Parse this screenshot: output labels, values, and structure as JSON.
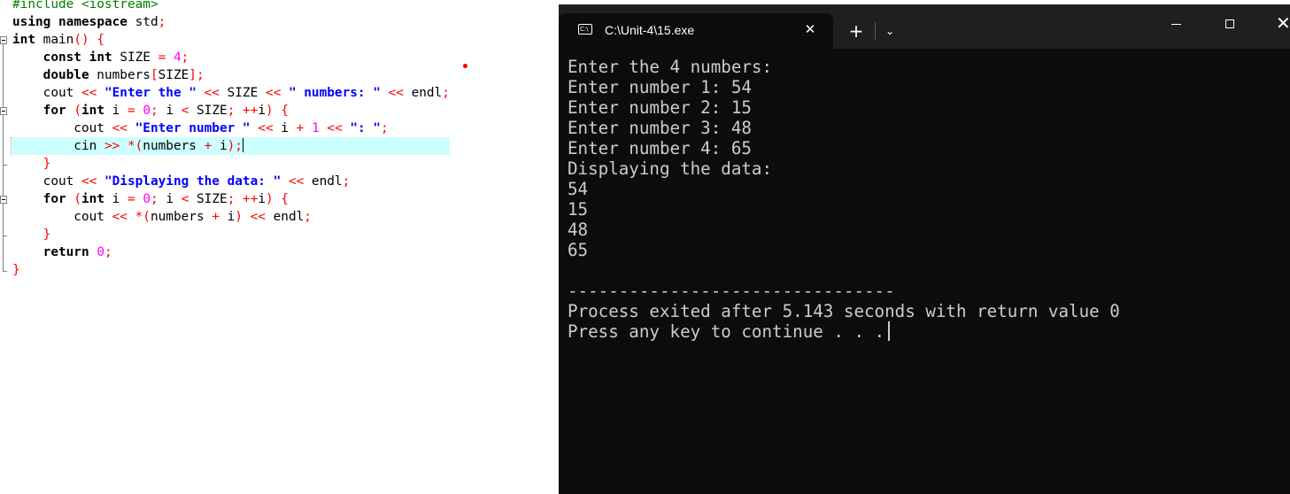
{
  "editor": {
    "lines": [
      {
        "tokens": [
          {
            "c": "pre",
            "t": "#include <iostream>"
          }
        ]
      },
      {
        "tokens": [
          {
            "c": "kw",
            "t": "using"
          },
          {
            "c": "plain",
            "t": " "
          },
          {
            "c": "kw",
            "t": "namespace"
          },
          {
            "c": "plain",
            "t": " std"
          },
          {
            "c": "op",
            "t": ";"
          }
        ]
      },
      {
        "tokens": [
          {
            "c": "kw",
            "t": "int"
          },
          {
            "c": "plain",
            "t": " main"
          },
          {
            "c": "op",
            "t": "()"
          },
          {
            "c": "plain",
            "t": " "
          },
          {
            "c": "op",
            "t": "{"
          }
        ]
      },
      {
        "tokens": [
          {
            "c": "plain",
            "t": "    "
          },
          {
            "c": "kw",
            "t": "const"
          },
          {
            "c": "plain",
            "t": " "
          },
          {
            "c": "kw",
            "t": "int"
          },
          {
            "c": "plain",
            "t": " SIZE "
          },
          {
            "c": "op",
            "t": "="
          },
          {
            "c": "plain",
            "t": " "
          },
          {
            "c": "num",
            "t": "4"
          },
          {
            "c": "op",
            "t": ";"
          }
        ]
      },
      {
        "tokens": [
          {
            "c": "plain",
            "t": "    "
          },
          {
            "c": "kw",
            "t": "double"
          },
          {
            "c": "plain",
            "t": " numbers"
          },
          {
            "c": "op",
            "t": "["
          },
          {
            "c": "plain",
            "t": "SIZE"
          },
          {
            "c": "op",
            "t": "];"
          }
        ]
      },
      {
        "tokens": [
          {
            "c": "plain",
            "t": "    cout "
          },
          {
            "c": "op",
            "t": "<<"
          },
          {
            "c": "plain",
            "t": " "
          },
          {
            "c": "str",
            "t": "\"Enter the \""
          },
          {
            "c": "plain",
            "t": " "
          },
          {
            "c": "op",
            "t": "<<"
          },
          {
            "c": "plain",
            "t": " SIZE "
          },
          {
            "c": "op",
            "t": "<<"
          },
          {
            "c": "plain",
            "t": " "
          },
          {
            "c": "str",
            "t": "\" numbers: \""
          },
          {
            "c": "plain",
            "t": " "
          },
          {
            "c": "op",
            "t": "<<"
          },
          {
            "c": "plain",
            "t": " endl"
          },
          {
            "c": "op",
            "t": ";"
          }
        ]
      },
      {
        "tokens": [
          {
            "c": "plain",
            "t": "    "
          },
          {
            "c": "kw",
            "t": "for"
          },
          {
            "c": "plain",
            "t": " "
          },
          {
            "c": "op",
            "t": "("
          },
          {
            "c": "kw",
            "t": "int"
          },
          {
            "c": "plain",
            "t": " i "
          },
          {
            "c": "op",
            "t": "="
          },
          {
            "c": "plain",
            "t": " "
          },
          {
            "c": "num",
            "t": "0"
          },
          {
            "c": "op",
            "t": ";"
          },
          {
            "c": "plain",
            "t": " i "
          },
          {
            "c": "op",
            "t": "<"
          },
          {
            "c": "plain",
            "t": " SIZE"
          },
          {
            "c": "op",
            "t": ";"
          },
          {
            "c": "plain",
            "t": " "
          },
          {
            "c": "op",
            "t": "++"
          },
          {
            "c": "plain",
            "t": "i"
          },
          {
            "c": "op",
            "t": ")"
          },
          {
            "c": "plain",
            "t": " "
          },
          {
            "c": "op",
            "t": "{"
          }
        ]
      },
      {
        "tokens": [
          {
            "c": "plain",
            "t": "        cout "
          },
          {
            "c": "op",
            "t": "<<"
          },
          {
            "c": "plain",
            "t": " "
          },
          {
            "c": "str",
            "t": "\"Enter number \""
          },
          {
            "c": "plain",
            "t": " "
          },
          {
            "c": "op",
            "t": "<<"
          },
          {
            "c": "plain",
            "t": " i "
          },
          {
            "c": "op",
            "t": "+"
          },
          {
            "c": "plain",
            "t": " "
          },
          {
            "c": "num",
            "t": "1"
          },
          {
            "c": "plain",
            "t": " "
          },
          {
            "c": "op",
            "t": "<<"
          },
          {
            "c": "plain",
            "t": " "
          },
          {
            "c": "str",
            "t": "\": \""
          },
          {
            "c": "op",
            "t": ";"
          }
        ]
      },
      {
        "active": true,
        "tokens": [
          {
            "c": "plain",
            "t": "        cin "
          },
          {
            "c": "op",
            "t": ">>"
          },
          {
            "c": "plain",
            "t": " "
          },
          {
            "c": "op",
            "t": "*("
          },
          {
            "c": "plain",
            "t": "numbers "
          },
          {
            "c": "op",
            "t": "+"
          },
          {
            "c": "plain",
            "t": " i"
          },
          {
            "c": "op",
            "t": ");"
          }
        ]
      },
      {
        "tokens": [
          {
            "c": "plain",
            "t": "    "
          },
          {
            "c": "op",
            "t": "}"
          }
        ]
      },
      {
        "tokens": [
          {
            "c": "plain",
            "t": "    cout "
          },
          {
            "c": "op",
            "t": "<<"
          },
          {
            "c": "plain",
            "t": " "
          },
          {
            "c": "str",
            "t": "\"Displaying the data: \""
          },
          {
            "c": "plain",
            "t": " "
          },
          {
            "c": "op",
            "t": "<<"
          },
          {
            "c": "plain",
            "t": " endl"
          },
          {
            "c": "op",
            "t": ";"
          }
        ]
      },
      {
        "tokens": [
          {
            "c": "plain",
            "t": "    "
          },
          {
            "c": "kw",
            "t": "for"
          },
          {
            "c": "plain",
            "t": " "
          },
          {
            "c": "op",
            "t": "("
          },
          {
            "c": "kw",
            "t": "int"
          },
          {
            "c": "plain",
            "t": " i "
          },
          {
            "c": "op",
            "t": "="
          },
          {
            "c": "plain",
            "t": " "
          },
          {
            "c": "num",
            "t": "0"
          },
          {
            "c": "op",
            "t": ";"
          },
          {
            "c": "plain",
            "t": " i "
          },
          {
            "c": "op",
            "t": "<"
          },
          {
            "c": "plain",
            "t": " SIZE"
          },
          {
            "c": "op",
            "t": ";"
          },
          {
            "c": "plain",
            "t": " "
          },
          {
            "c": "op",
            "t": "++"
          },
          {
            "c": "plain",
            "t": "i"
          },
          {
            "c": "op",
            "t": ")"
          },
          {
            "c": "plain",
            "t": " "
          },
          {
            "c": "op",
            "t": "{"
          }
        ]
      },
      {
        "tokens": [
          {
            "c": "plain",
            "t": "        cout "
          },
          {
            "c": "op",
            "t": "<<"
          },
          {
            "c": "plain",
            "t": " "
          },
          {
            "c": "op",
            "t": "*("
          },
          {
            "c": "plain",
            "t": "numbers "
          },
          {
            "c": "op",
            "t": "+"
          },
          {
            "c": "plain",
            "t": " i"
          },
          {
            "c": "op",
            "t": ")"
          },
          {
            "c": "plain",
            "t": " "
          },
          {
            "c": "op",
            "t": "<<"
          },
          {
            "c": "plain",
            "t": " endl"
          },
          {
            "c": "op",
            "t": ";"
          }
        ]
      },
      {
        "tokens": [
          {
            "c": "plain",
            "t": "    "
          },
          {
            "c": "op",
            "t": "}"
          }
        ]
      },
      {
        "tokens": [
          {
            "c": "plain",
            "t": "    "
          },
          {
            "c": "kw",
            "t": "return"
          },
          {
            "c": "plain",
            "t": " "
          },
          {
            "c": "num",
            "t": "0"
          },
          {
            "c": "op",
            "t": ";"
          }
        ]
      },
      {
        "tokens": [
          {
            "c": "op",
            "t": "}"
          }
        ]
      }
    ]
  },
  "terminal": {
    "tab_title": "C:\\Unit-4\\15.exe",
    "tab_icon_text": "C:\\",
    "close_tab_glyph": "✕",
    "new_tab_glyph": "+",
    "dropdown_glyph": "⌄",
    "close_window_glyph": "✕",
    "output": [
      "Enter the 4 numbers:",
      "Enter number 1: 54",
      "Enter number 2: 15",
      "Enter number 3: 48",
      "Enter number 4: 65",
      "Displaying the data:",
      "54",
      "15",
      "48",
      "65",
      "",
      "--------------------------------",
      "Process exited after 5.143 seconds with return value 0",
      "Press any key to continue . . ."
    ]
  },
  "colors": {
    "active_line": "#ccffff",
    "keyword": "#000000",
    "string": "#0000ff",
    "number": "#ff00ff",
    "operator": "#ff0000",
    "preprocessor": "#008000",
    "terminal_bg": "#0c0c0c",
    "terminal_text": "#cccccc"
  }
}
